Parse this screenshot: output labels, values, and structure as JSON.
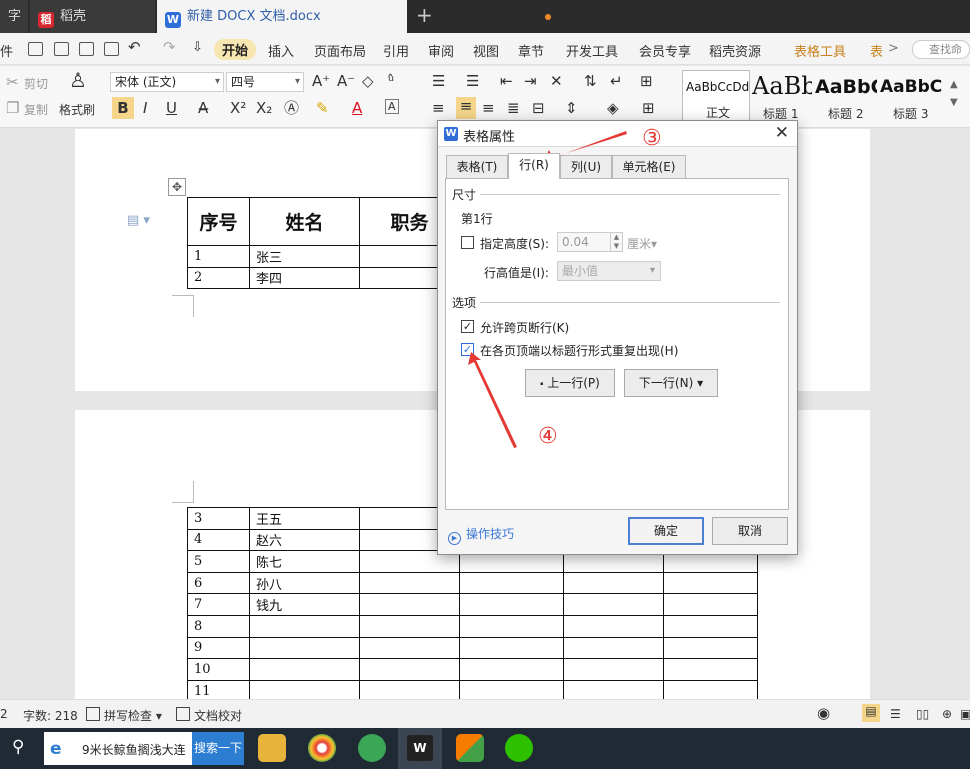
{
  "tabs": [
    {
      "label": "字"
    },
    {
      "label": "稻壳"
    },
    {
      "label": "新建 DOCX 文档.docx"
    }
  ],
  "tab_icons": {
    "docer": "docer-icon",
    "writer": "W"
  },
  "new_tab": "+",
  "menu": {
    "file": "件",
    "items": [
      "开始",
      "插入",
      "页面布局",
      "引用",
      "审阅",
      "视图",
      "章节",
      "开发工具",
      "会员专享",
      "稻壳资源"
    ],
    "table_tools": "表格工具",
    "table_style": "表",
    "more": ">",
    "search_placeholder": "查找命"
  },
  "ribbon": {
    "cut": "剪切",
    "copy": "复制",
    "format_painter": "格式刷",
    "font_name": "宋体 (正文)",
    "font_size": "四号",
    "styles": [
      {
        "sample": "AaBbCcDd",
        "label": "正文"
      },
      {
        "sample": "AaBb",
        "label": "标题 1"
      },
      {
        "sample": "AaBbC",
        "label": "标题 2"
      },
      {
        "sample": "AaBbC",
        "label": "标题 3"
      }
    ]
  },
  "document": {
    "headers": [
      "序号",
      "姓名",
      "职务"
    ],
    "rows_p1": [
      [
        "1",
        "张三"
      ],
      [
        "2",
        "李四"
      ]
    ],
    "rows_p2": [
      [
        "3",
        "王五"
      ],
      [
        "4",
        "赵六"
      ],
      [
        "5",
        "陈七"
      ],
      [
        "6",
        "孙八"
      ],
      [
        "7",
        "钱九"
      ],
      [
        "8",
        ""
      ],
      [
        "9",
        ""
      ],
      [
        "10",
        ""
      ],
      [
        "11",
        ""
      ]
    ]
  },
  "dialog": {
    "title": "表格属性",
    "close": "✕",
    "tabs": [
      "表格(T)",
      "行(R)",
      "列(U)",
      "单元格(E)"
    ],
    "size_section": "尺寸",
    "row_label": "第1行",
    "specify_height": "指定高度(S):",
    "height_value": "0.04",
    "unit": "厘米",
    "row_height_is": "行高值是(I):",
    "row_height_mode": "最小值",
    "options_section": "选项",
    "allow_break": "允许跨页断行(K)",
    "repeat_header": "在各页顶端以标题行形式重复出现(H)",
    "prev_row": "上一行(P)",
    "next_row": "下一行(N)",
    "tips": "操作技巧",
    "ok": "确定",
    "cancel": "取消"
  },
  "annotations": {
    "step3": "③",
    "step4": "④"
  },
  "statusbar": {
    "page": "2",
    "word_count": "字数: 218",
    "spell_check": "拼写检查",
    "doc_check": "文档校对"
  },
  "taskbar": {
    "search_query": "9米长鲸鱼搁浅大连",
    "search_button": "搜索一下"
  }
}
